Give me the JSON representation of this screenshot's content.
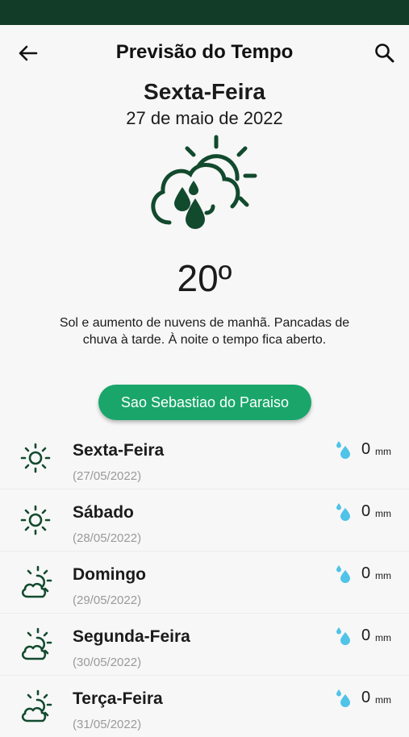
{
  "app_bar": {
    "title": "Previsão do Tempo"
  },
  "today": {
    "day": "Sexta-Feira",
    "date": "27 de maio de 2022",
    "icon": "sun-cloud-rain-icon",
    "temperature": "20º",
    "description": "Sol e aumento de nuvens de manhã. Pancadas de chuva à tarde. À noite o tempo fica aberto."
  },
  "city": {
    "label": "Sao Sebastiao do Paraiso"
  },
  "forecast": [
    {
      "day": "Sexta-Feira",
      "date": "(27/05/2022)",
      "icon": "sun-icon",
      "rain_value": "0",
      "rain_unit": "mm"
    },
    {
      "day": "Sábado",
      "date": "(28/05/2022)",
      "icon": "sun-icon",
      "rain_value": "0",
      "rain_unit": "mm"
    },
    {
      "day": "Domingo",
      "date": "(29/05/2022)",
      "icon": "sun-cloud-icon",
      "rain_value": "0",
      "rain_unit": "mm"
    },
    {
      "day": "Segunda-Feira",
      "date": "(30/05/2022)",
      "icon": "sun-cloud-icon",
      "rain_value": "0",
      "rain_unit": "mm"
    },
    {
      "day": "Terça-Feira",
      "date": "(31/05/2022)",
      "icon": "sun-cloud-icon",
      "rain_value": "0",
      "rain_unit": "mm"
    }
  ],
  "colors": {
    "status_bar": "#123c27",
    "accent": "#1aa66a",
    "icon_dark_green": "#124a2e",
    "rain_icon": "#4fc3e8"
  }
}
